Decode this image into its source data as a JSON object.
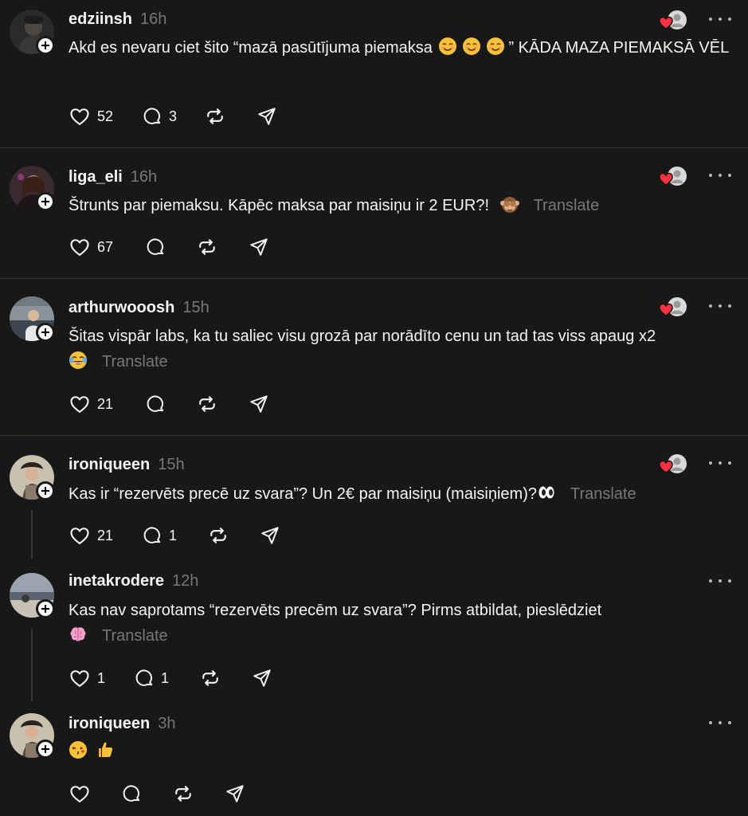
{
  "posts": [
    {
      "username": "edziinsh",
      "time": "16h",
      "text": "Akd es nevaru ciet šito “mazā pasūtījuma piemaksa",
      "text_suffix": "” KĀDA MAZA PIEMAKSĀ VĒL",
      "emojis": [
        "smiling-face-emoji",
        "smiling-face-emoji",
        "smiling-face-emoji"
      ],
      "likes": "52",
      "replies": "3",
      "show_translate": false
    },
    {
      "username": "liga_eli",
      "time": "16h",
      "text": "Štrunts par piemaksu. Kāpēc maksa par maisiņu ir 2 EUR?!",
      "emojis": [
        "see-no-evil-monkey-emoji"
      ],
      "likes": "67",
      "replies": "",
      "translate": "Translate"
    },
    {
      "username": "arthurwooosh",
      "time": "15h",
      "text": "Šitas vispār labs, ka tu saliec visu grozā par norādīto cenu un tad tas viss apaug x2",
      "emojis": [
        "tears-of-joy-emoji"
      ],
      "likes": "21",
      "replies": "",
      "translate": "Translate"
    },
    {
      "username": "ironiqueen",
      "time": "15h",
      "text": "Kas ir “rezervēts precē uz svara”? Un 2€ par maisiņu (maisiņiem)?",
      "emojis": [
        "eyes-emoji"
      ],
      "likes": "21",
      "replies": "1",
      "translate": "Translate"
    },
    {
      "username": "inetakrodere",
      "time": "12h",
      "text": "Kas nav saprotams “rezervēts precēm uz svara”? Pirms atbildat, pieslēdziet",
      "emojis": [
        "brain-emoji"
      ],
      "likes": "1",
      "replies": "1",
      "translate": "Translate"
    },
    {
      "username": "ironiqueen",
      "time": "3h",
      "text": "",
      "emojis": [
        "face-blowing-kiss-emoji",
        "thumbs-up-emoji"
      ],
      "likes": "",
      "replies": ""
    }
  ],
  "colors": {
    "background": "#181818",
    "text": "#f3f5f7",
    "muted": "#777777",
    "divider": "#323232",
    "heart": "#ff3040"
  }
}
